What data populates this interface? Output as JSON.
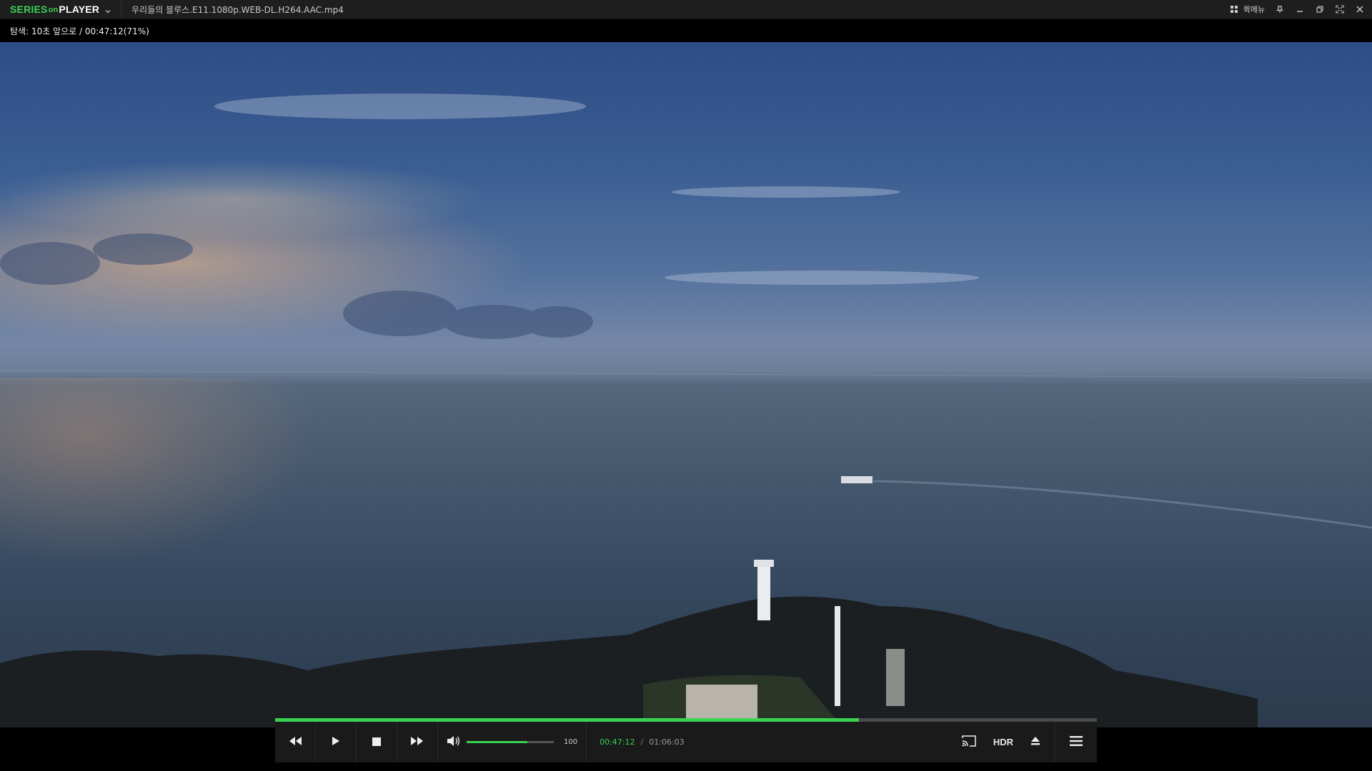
{
  "app": {
    "brand_series": "SERIES",
    "brand_link": "on",
    "brand_player": "PLAYER",
    "file_title": "우리들의 블루스.E11.1080p.WEB-DL.H264.AAC.mp4",
    "quick_menu_label": "퀵메뉴"
  },
  "osd": {
    "message": "탐색: 10초 앞으로 / 00:47:12(71%)"
  },
  "player": {
    "progress_fraction": 0.71,
    "volume_value": "100",
    "volume_fraction": 0.7,
    "current_time": "00:47:12",
    "time_separator": "/",
    "total_time": "01:06:03",
    "hdr_label": "HDR"
  },
  "colors": {
    "accent": "#39d353",
    "titlebar": "#1e1e1e",
    "panel": "#1a1a1a"
  },
  "icons": {
    "rewind": "rewind-icon",
    "play": "play-icon",
    "stop": "stop-icon",
    "forward": "fast-forward-icon",
    "volume": "volume-icon",
    "cast": "cast-icon",
    "eject": "eject-icon",
    "menu": "menu-icon",
    "grid": "grid-icon",
    "pin": "pin-icon",
    "minimize": "minimize-icon",
    "restore": "restore-icon",
    "fullscreen": "fullscreen-icon",
    "close": "close-icon"
  }
}
